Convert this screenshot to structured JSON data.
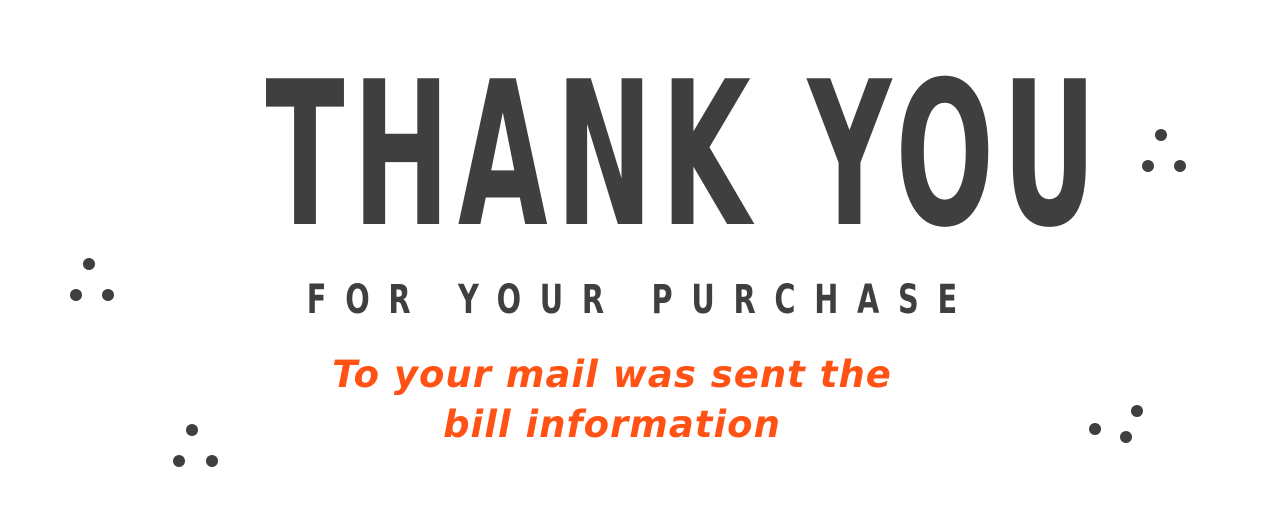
{
  "headline": "THANK YOU",
  "subline": "FOR YOUR PURCHASE",
  "message": {
    "line1": "To your mail was sent the",
    "line2": "bill information"
  },
  "colors": {
    "text_dark": "#3f3f3f",
    "accent": "#ff5214",
    "background": "#ffffff"
  }
}
